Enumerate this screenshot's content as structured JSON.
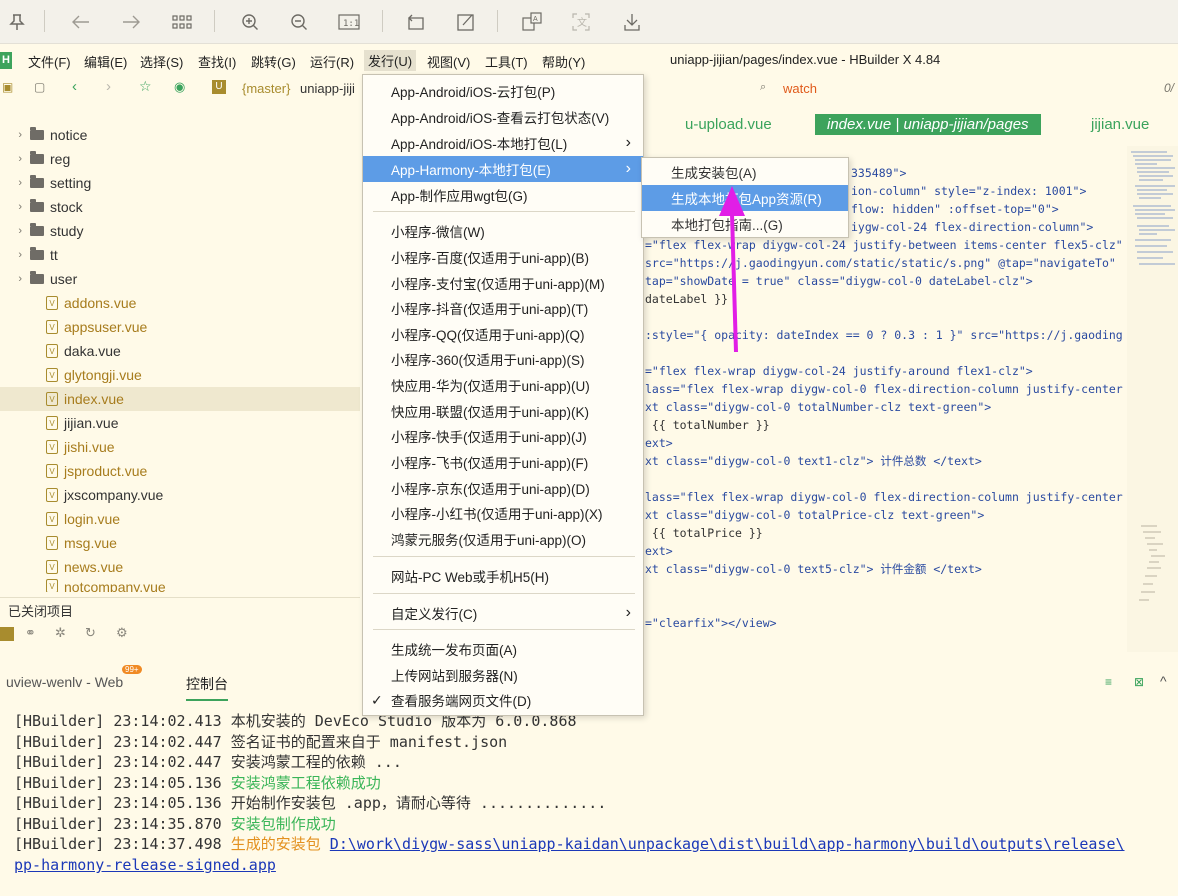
{
  "window": {
    "title": "uniapp-jijian/pages/index.vue - HBuilder X 4.84"
  },
  "menubar": [
    {
      "label": "文件(F)",
      "key": "F"
    },
    {
      "label": "编辑(E)",
      "key": "E"
    },
    {
      "label": "选择(S)",
      "key": "S"
    },
    {
      "label": "查找(I)",
      "key": "I"
    },
    {
      "label": "跳转(G)",
      "key": "G"
    },
    {
      "label": "运行(R)",
      "key": "R"
    },
    {
      "label": "发行(U)",
      "key": "U"
    },
    {
      "label": "视图(V)",
      "key": "V"
    },
    {
      "label": "工具(T)",
      "key": "T"
    },
    {
      "label": "帮助(Y)",
      "key": "Y"
    }
  ],
  "bar2": {
    "branch": "{master}",
    "project": "uniapp-jiji",
    "search_icon_label": "watch",
    "page_indicator": "0/"
  },
  "tree": {
    "folders": [
      "notice",
      "reg",
      "setting",
      "stock",
      "study",
      "tt",
      "user"
    ],
    "files": [
      "addons.vue",
      "appsuser.vue",
      "daka.vue",
      "glytongji.vue",
      "index.vue",
      "jijian.vue",
      "jishi.vue",
      "jsproduct.vue",
      "jxscompany.vue",
      "login.vue",
      "msg.vue",
      "news.vue",
      "notcompany.vue"
    ],
    "selected_file": "index.vue",
    "closed_projects_label": "已关闭项目"
  },
  "editor": {
    "tabs": [
      "u-upload.vue",
      "index.vue | uniapp-jijian/pages",
      "jijian.vue"
    ],
    "lines": [
      "335489\">",
      "ion-column\" style=\"z-index: 1001\">",
      "flow: hidden\" :offset-top=\"0\">",
      "iygw-col-24 flex-direction-column\">",
      "=\"flex flex-wrap diygw-col-24 justify-between items-center flex5-clz\"",
      "src=\"https://j.gaodingyun.com/static/static/s.png\" @tap=\"navigateTo\" (",
      "tap=\"showDate = true\" class=\"diygw-col-0 dateLabel-clz\">",
      "dateLabel }}",
      "",
      ":style=\"{ opacity: dateIndex == 0 ? 0.3 : 1 }\" src=\"https://j.gaoding",
      "",
      "=\"flex flex-wrap diygw-col-24 justify-around flex1-clz\">",
      "lass=\"flex flex-wrap diygw-col-0 flex-direction-column justify-center",
      "xt class=\"diygw-col-0 totalNumber-clz text-green\">",
      " {{ totalNumber }}",
      "ext>",
      "xt class=\"diygw-col-0 text1-clz\"> 计件总数 </text>",
      "",
      "lass=\"flex flex-wrap diygw-col-0 flex-direction-column justify-center",
      "xt class=\"diygw-col-0 totalPrice-clz text-green\">",
      " {{ totalPrice }}",
      "ext>",
      "xt class=\"diygw-col-0 text5-clz\"> 计件金额 </text>",
      "",
      "",
      "=\"clearfix\"></view>"
    ]
  },
  "console": {
    "tabs": [
      "uview-wenlv - Web",
      "控制台"
    ],
    "badge": "99+",
    "logs": [
      {
        "prefix": "[HBuilder] 23:14:02.413 ",
        "text": "本机安装的 DevEco Studio 版本为 6.0.0.868",
        "style": "normal"
      },
      {
        "prefix": "[HBuilder] 23:14:02.447 ",
        "text": "签名证书的配置来自于 manifest.json",
        "style": "normal"
      },
      {
        "prefix": "[HBuilder] 23:14:02.447 ",
        "text": "安装鸿蒙工程的依赖 ...",
        "style": "normal"
      },
      {
        "prefix": "[HBuilder] 23:14:05.136 ",
        "text": "安装鸿蒙工程依赖成功",
        "style": "green"
      },
      {
        "prefix": "[HBuilder] 23:14:05.136 ",
        "text": "开始制作安装包 .app，请耐心等待 ..............",
        "style": "normal"
      },
      {
        "prefix": "[HBuilder] 23:14:35.870 ",
        "text": "安装包制作成功",
        "style": "green"
      },
      {
        "prefix": "[HBuilder] 23:14:37.498 ",
        "text": "生成的安装包 ",
        "style": "orange",
        "link": "D:\\work\\diygw-sass\\uniapp-kaidan\\unpackage\\dist\\build\\app-harmony\\build\\outputs\\release\\"
      }
    ],
    "link_cont": "pp-harmony-release-signed.app"
  },
  "release_menu": {
    "items": [
      {
        "label": "App-Android/iOS-云打包(P)",
        "submenu": false
      },
      {
        "label": "App-Android/iOS-查看云打包状态(V)",
        "submenu": false
      },
      {
        "label": "App-Android/iOS-本地打包(L)",
        "submenu": true
      },
      {
        "label": "App-Harmony-本地打包(E)",
        "submenu": true,
        "highlight": true
      },
      {
        "label": "App-制作应用wgt包(G)",
        "submenu": false
      },
      {
        "label": "小程序-微信(W)",
        "submenu": false
      },
      {
        "label": "小程序-百度(仅适用于uni-app)(B)",
        "submenu": false
      },
      {
        "label": "小程序-支付宝(仅适用于uni-app)(M)",
        "submenu": false
      },
      {
        "label": "小程序-抖音(仅适用于uni-app)(T)",
        "submenu": false
      },
      {
        "label": "小程序-QQ(仅适用于uni-app)(Q)",
        "submenu": false
      },
      {
        "label": "小程序-360(仅适用于uni-app)(S)",
        "submenu": false
      },
      {
        "label": "快应用-华为(仅适用于uni-app)(U)",
        "submenu": false
      },
      {
        "label": "快应用-联盟(仅适用于uni-app)(K)",
        "submenu": false
      },
      {
        "label": "小程序-快手(仅适用于uni-app)(J)",
        "submenu": false
      },
      {
        "label": "小程序-飞书(仅适用于uni-app)(F)",
        "submenu": false
      },
      {
        "label": "小程序-京东(仅适用于uni-app)(D)",
        "submenu": false
      },
      {
        "label": "小程序-小红书(仅适用于uni-app)(X)",
        "submenu": false
      },
      {
        "label": "鸿蒙元服务(仅适用于uni-app)(O)",
        "submenu": false
      },
      {
        "label": "网站-PC Web或手机H5(H)",
        "submenu": false
      },
      {
        "label": "自定义发行(C)",
        "submenu": true
      },
      {
        "label": "生成统一发布页面(A)",
        "submenu": false
      },
      {
        "label": "上传网站到服务器(N)",
        "submenu": false
      },
      {
        "label": "查看服务端网页文件(D)",
        "submenu": false,
        "checked": true
      }
    ]
  },
  "harmony_submenu": {
    "items": [
      {
        "label": "生成安装包(A)"
      },
      {
        "label": "生成本地打包App资源(R)",
        "highlight": true
      },
      {
        "label": "本地打包指南...(G)"
      }
    ]
  },
  "colors": {
    "highlight": "#5d9ce6",
    "accent_green": "#3da35c",
    "pointer": "#e11ee6"
  }
}
